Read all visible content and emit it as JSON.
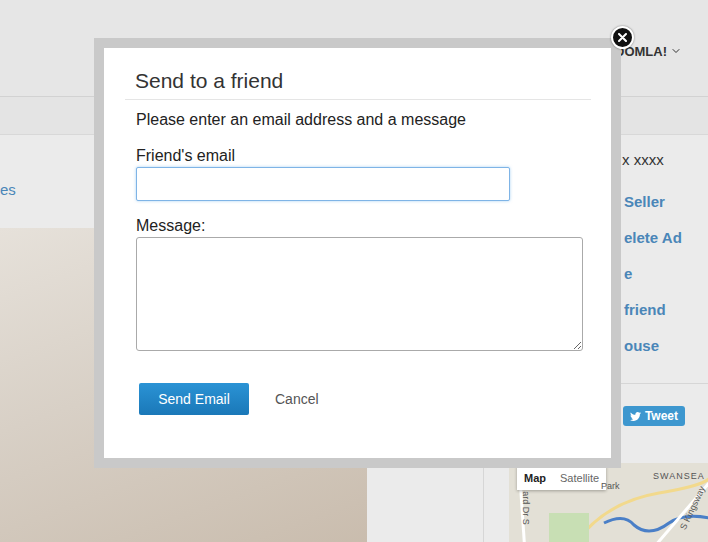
{
  "page": {
    "nav": {
      "label": "OOMLA!"
    },
    "left_link": "es",
    "contact": "x xxxx",
    "sidebar_links": [
      "Seller",
      "elete Ad",
      "e",
      "friend",
      "ouse"
    ],
    "tweet": "Tweet",
    "map": {
      "buttons": [
        {
          "label": "Map",
          "selected": true
        },
        {
          "label": "Satellite",
          "selected": false
        }
      ],
      "labels": [
        "Park",
        "SWANSEA",
        "ard Dr S",
        "S Kingsway"
      ]
    }
  },
  "dialog": {
    "title": "Send to a friend",
    "intro": "Please enter an email address and a message",
    "fields": [
      {
        "label": "Friend's email",
        "kind": "input",
        "value": "",
        "focused": true
      },
      {
        "label": "Message:",
        "kind": "textarea",
        "value": "",
        "focused": false
      }
    ],
    "buttons": [
      {
        "label": "Send Email",
        "kind": "primary"
      },
      {
        "label": "Cancel",
        "kind": "link"
      }
    ]
  }
}
